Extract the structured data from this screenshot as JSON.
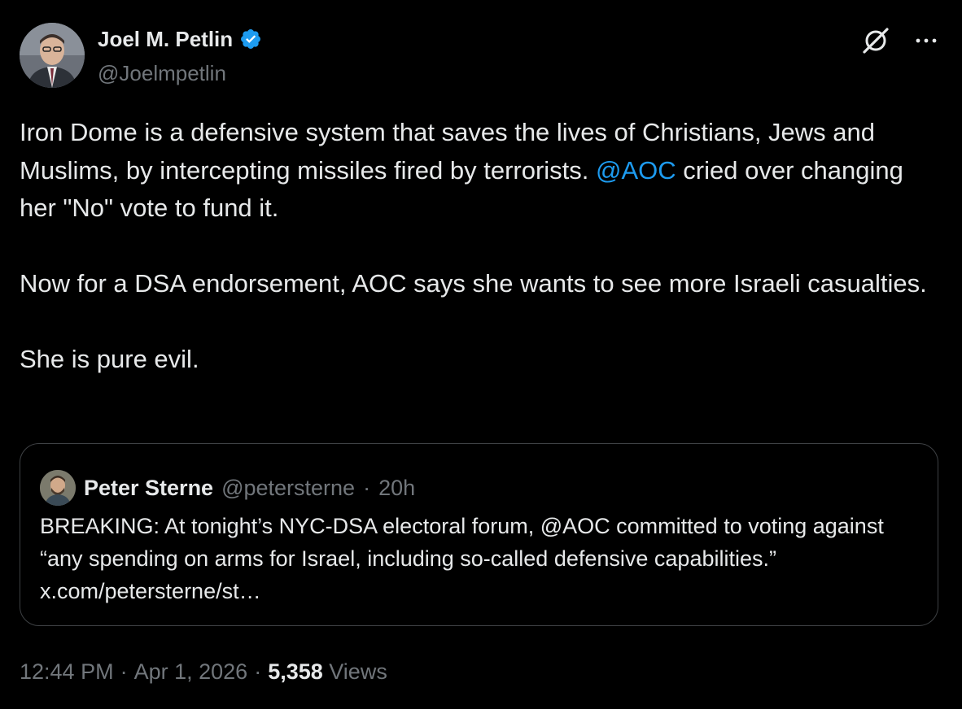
{
  "author": {
    "display_name": "Joel M. Petlin",
    "handle": "@Joelmpetlin",
    "verified": true,
    "verified_icon": "verified-badge-icon",
    "avatar_icon": "avatar"
  },
  "actions": {
    "grok_icon": "grok-icon",
    "more_icon": "more-options-icon"
  },
  "tweet": {
    "p1_a": "Iron Dome is a defensive system that saves the lives of Christians, Jews and Muslims, by intercepting missiles fired by terrorists. ",
    "p1_mention": "@AOC",
    "p1_b": " cried over changing her \"No\" vote to fund it.",
    "p2": "Now for a DSA endorsement, AOC says she wants to see more Israeli casualties.",
    "p3": "She is pure evil."
  },
  "quote": {
    "display_name": "Peter Sterne",
    "handle": "@petersterne",
    "separator": "·",
    "time": "20h",
    "text": "BREAKING: At tonight’s NYC-DSA electoral forum, @AOC committed to voting against “any spending on arms for Israel, including so-called defensive capabilities.” x.com/petersterne/st…"
  },
  "footer": {
    "time": "12:44 PM",
    "sep1": "·",
    "date": "Apr 1, 2026",
    "sep2": "·",
    "views_count": "5,358",
    "views_label": "Views"
  },
  "colors": {
    "background": "#000000",
    "text": "#e7e9ea",
    "secondary": "#71767b",
    "accent": "#1d9bf0",
    "border": "#3e4144"
  }
}
